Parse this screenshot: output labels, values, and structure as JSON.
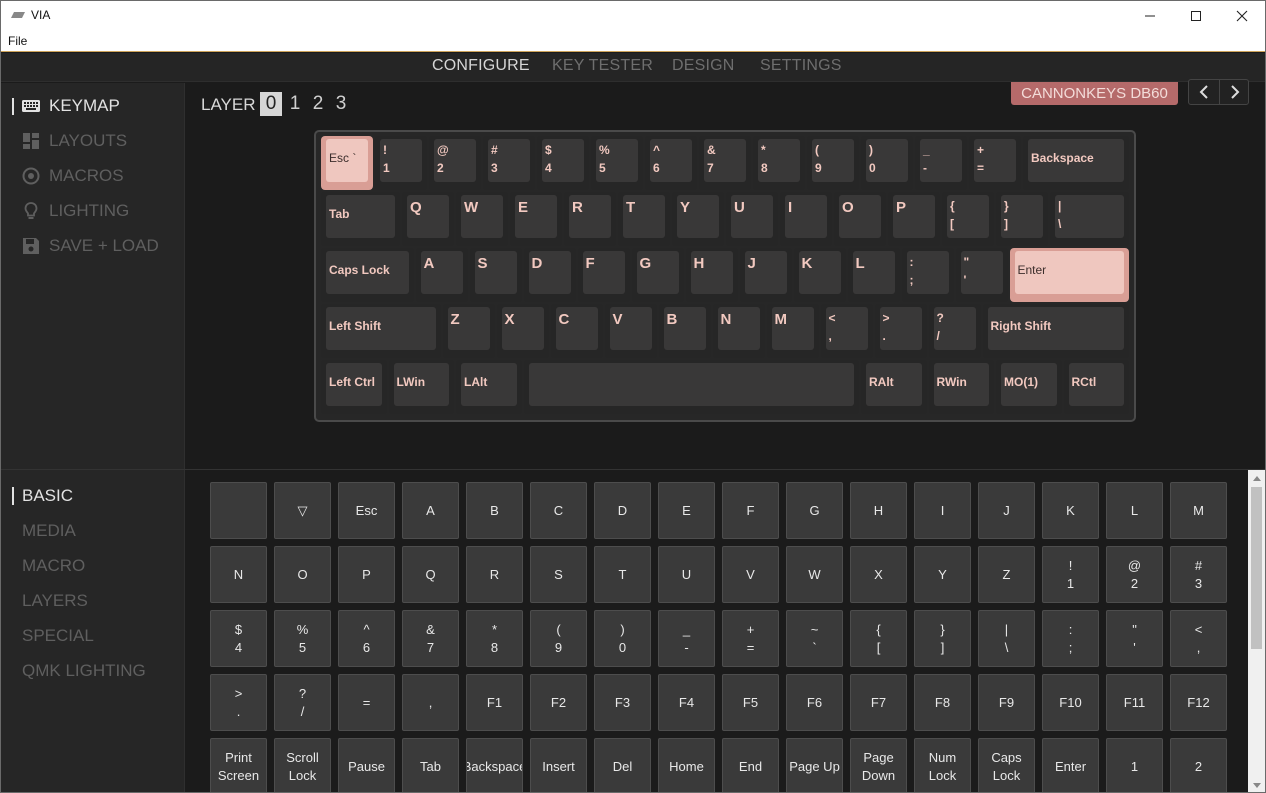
{
  "window": {
    "title": "VIA"
  },
  "menu": {
    "file": "File"
  },
  "topnav": [
    {
      "label": "CONFIGURE",
      "active": true
    },
    {
      "label": "KEY TESTER",
      "active": false
    },
    {
      "label": "DESIGN",
      "active": false
    },
    {
      "label": "SETTINGS",
      "active": false
    }
  ],
  "sidebar": {
    "items": [
      {
        "label": "KEYMAP",
        "icon": "keyboard-icon",
        "active": true
      },
      {
        "label": "LAYOUTS",
        "icon": "layouts-icon",
        "active": false
      },
      {
        "label": "MACROS",
        "icon": "macro-circle-icon",
        "active": false
      },
      {
        "label": "LIGHTING",
        "icon": "lightbulb-icon",
        "active": false
      },
      {
        "label": "SAVE + LOAD",
        "icon": "floppy-disk-icon",
        "active": false
      }
    ]
  },
  "layer": {
    "label": "LAYER",
    "options": [
      "0",
      "1",
      "2",
      "3"
    ],
    "active": "0"
  },
  "device": {
    "name": "CANNONKEYS DB60"
  },
  "keyboard": {
    "rows": [
      [
        {
          "top": "Esc `",
          "hl": true
        },
        {
          "top": "!",
          "bottom": "1"
        },
        {
          "top": "@",
          "bottom": "2"
        },
        {
          "top": "#",
          "bottom": "3"
        },
        {
          "top": "$",
          "bottom": "4"
        },
        {
          "top": "%",
          "bottom": "5"
        },
        {
          "top": "^",
          "bottom": "6"
        },
        {
          "top": "&",
          "bottom": "7"
        },
        {
          "top": "*",
          "bottom": "8"
        },
        {
          "top": "(",
          "bottom": "9"
        },
        {
          "top": ")",
          "bottom": "0"
        },
        {
          "top": "_",
          "bottom": "-"
        },
        {
          "top": "+",
          "bottom": "="
        },
        {
          "top": "Backspace"
        }
      ],
      [
        {
          "top": "Tab"
        },
        {
          "top": "Q",
          "big": true
        },
        {
          "top": "W",
          "big": true
        },
        {
          "top": "E",
          "big": true
        },
        {
          "top": "R",
          "big": true
        },
        {
          "top": "T",
          "big": true
        },
        {
          "top": "Y",
          "big": true
        },
        {
          "top": "U",
          "big": true
        },
        {
          "top": "I",
          "big": true
        },
        {
          "top": "O",
          "big": true
        },
        {
          "top": "P",
          "big": true
        },
        {
          "top": "{",
          "bottom": "["
        },
        {
          "top": "}",
          "bottom": "]"
        },
        {
          "top": "|",
          "bottom": "\\"
        }
      ],
      [
        {
          "top": "Caps Lock"
        },
        {
          "top": "A",
          "big": true
        },
        {
          "top": "S",
          "big": true
        },
        {
          "top": "D",
          "big": true
        },
        {
          "top": "F",
          "big": true
        },
        {
          "top": "G",
          "big": true
        },
        {
          "top": "H",
          "big": true
        },
        {
          "top": "J",
          "big": true
        },
        {
          "top": "K",
          "big": true
        },
        {
          "top": "L",
          "big": true
        },
        {
          "top": ":",
          "bottom": ";"
        },
        {
          "top": "\"",
          "bottom": "'"
        },
        {
          "top": "Enter",
          "hl": true
        }
      ],
      [
        {
          "top": "Left Shift"
        },
        {
          "top": "Z",
          "big": true
        },
        {
          "top": "X",
          "big": true
        },
        {
          "top": "C",
          "big": true
        },
        {
          "top": "V",
          "big": true
        },
        {
          "top": "B",
          "big": true
        },
        {
          "top": "N",
          "big": true
        },
        {
          "top": "M",
          "big": true
        },
        {
          "top": "<",
          "bottom": ","
        },
        {
          "top": ">",
          "bottom": "."
        },
        {
          "top": "?",
          "bottom": "/"
        },
        {
          "top": "Right Shift"
        }
      ],
      [
        {
          "top": "Left Ctrl"
        },
        {
          "top": "LWin"
        },
        {
          "top": "LAlt"
        },
        {
          "top": ""
        },
        {
          "top": "RAlt"
        },
        {
          "top": "RWin"
        },
        {
          "top": "MO(1)"
        },
        {
          "top": "RCtl"
        }
      ]
    ]
  },
  "categories": [
    {
      "label": "BASIC",
      "active": true
    },
    {
      "label": "MEDIA",
      "active": false
    },
    {
      "label": "MACRO",
      "active": false
    },
    {
      "label": "LAYERS",
      "active": false
    },
    {
      "label": "SPECIAL",
      "active": false
    },
    {
      "label": "QMK LIGHTING",
      "active": false
    }
  ],
  "keycodes": [
    [
      [
        ""
      ],
      [
        "▽"
      ],
      [
        "Esc"
      ],
      [
        "A"
      ],
      [
        "B"
      ],
      [
        "C"
      ],
      [
        "D"
      ],
      [
        "E"
      ],
      [
        "F"
      ],
      [
        "G"
      ],
      [
        "H"
      ],
      [
        "I"
      ],
      [
        "J"
      ],
      [
        "K"
      ],
      [
        "L"
      ],
      [
        "M"
      ]
    ],
    [
      [
        "N"
      ],
      [
        "O"
      ],
      [
        "P"
      ],
      [
        "Q"
      ],
      [
        "R"
      ],
      [
        "S"
      ],
      [
        "T"
      ],
      [
        "U"
      ],
      [
        "V"
      ],
      [
        "W"
      ],
      [
        "X"
      ],
      [
        "Y"
      ],
      [
        "Z"
      ],
      [
        "!",
        "1"
      ],
      [
        "@",
        "2"
      ],
      [
        "#",
        "3"
      ]
    ],
    [
      [
        "$",
        "4"
      ],
      [
        "%",
        "5"
      ],
      [
        "^",
        "6"
      ],
      [
        "&",
        "7"
      ],
      [
        "*",
        "8"
      ],
      [
        "(",
        "9"
      ],
      [
        ")",
        "0"
      ],
      [
        "_",
        "-"
      ],
      [
        "+",
        "="
      ],
      [
        "~",
        "`"
      ],
      [
        "{",
        "["
      ],
      [
        "}",
        "]"
      ],
      [
        "|",
        "\\"
      ],
      [
        ":",
        ";"
      ],
      [
        "\"",
        "'"
      ],
      [
        "<",
        ","
      ]
    ],
    [
      [
        ">",
        "."
      ],
      [
        "?",
        "/"
      ],
      [
        "="
      ],
      [
        ","
      ],
      [
        "F1"
      ],
      [
        "F2"
      ],
      [
        "F3"
      ],
      [
        "F4"
      ],
      [
        "F5"
      ],
      [
        "F6"
      ],
      [
        "F7"
      ],
      [
        "F8"
      ],
      [
        "F9"
      ],
      [
        "F10"
      ],
      [
        "F11"
      ],
      [
        "F12"
      ]
    ],
    [
      [
        "Print",
        "Screen"
      ],
      [
        "Scroll",
        "Lock"
      ],
      [
        "Pause"
      ],
      [
        "Tab"
      ],
      [
        "Backspace"
      ],
      [
        "Insert"
      ],
      [
        "Del"
      ],
      [
        "Home"
      ],
      [
        "End"
      ],
      [
        "Page Up"
      ],
      [
        "Page",
        "Down"
      ],
      [
        "Num",
        "Lock"
      ],
      [
        "Caps",
        "Lock"
      ],
      [
        "Enter"
      ],
      [
        "1"
      ],
      [
        "2"
      ]
    ]
  ],
  "colors": {
    "accent": "#b56a6a",
    "highlight_key": "#efc7bf",
    "legend": "#f2c9c0"
  }
}
